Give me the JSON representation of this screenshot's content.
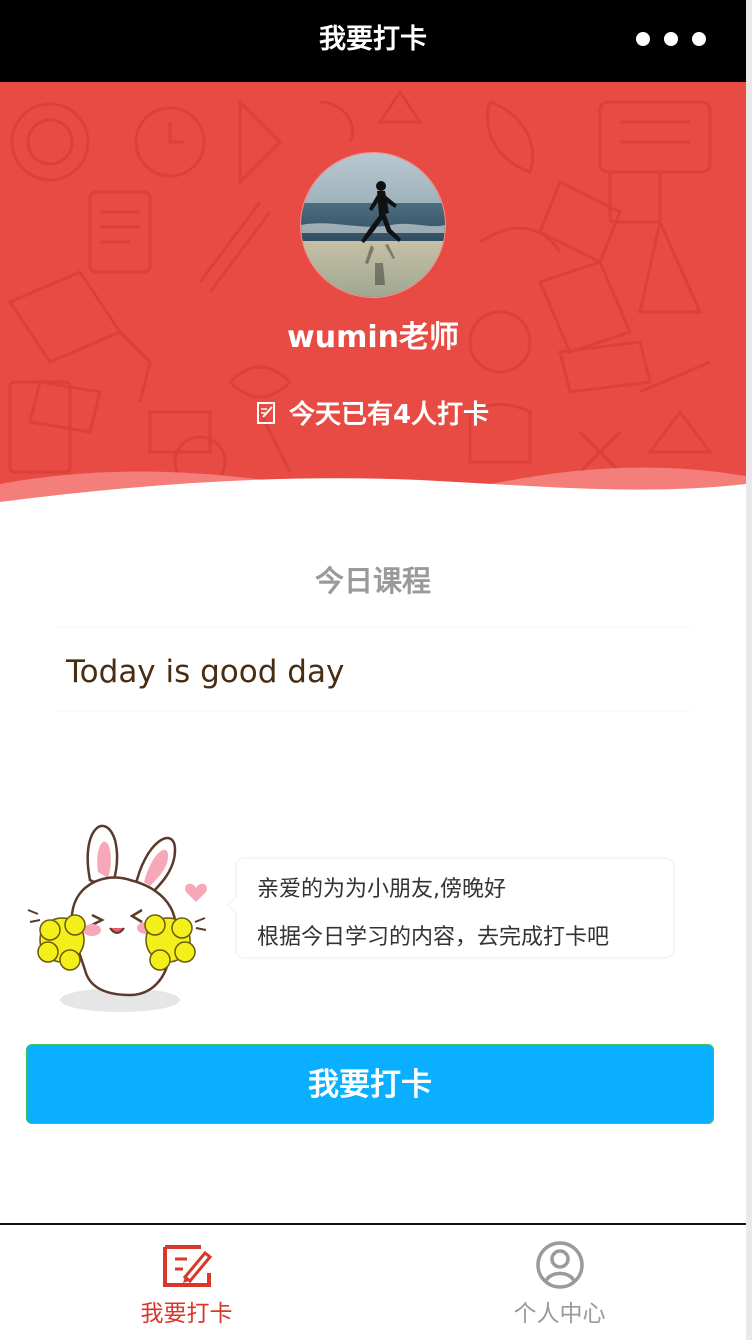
{
  "navbar": {
    "title": "我要打卡"
  },
  "banner": {
    "teacher_name": "wumin老师",
    "checkin_count_text": "今天已有4人打卡"
  },
  "course": {
    "heading": "今日课程",
    "content": "Today is good day"
  },
  "greeting": {
    "line1": "亲爱的为为小朋友,傍晚好",
    "line2": "根据今日学习的内容，去完成打卡吧"
  },
  "checkin_button": {
    "label": "我要打卡"
  },
  "tabbar": {
    "tabs": [
      {
        "label": "我要打卡",
        "icon": "checkin-edit-icon",
        "active": true
      },
      {
        "label": "个人中心",
        "icon": "user-profile-icon",
        "active": false
      }
    ]
  },
  "colors": {
    "banner": "#e84b44",
    "button": "#0aafff",
    "tab_active": "#d9372b",
    "tab_inactive": "#9a9a9a",
    "course_text": "#4a2c12"
  }
}
